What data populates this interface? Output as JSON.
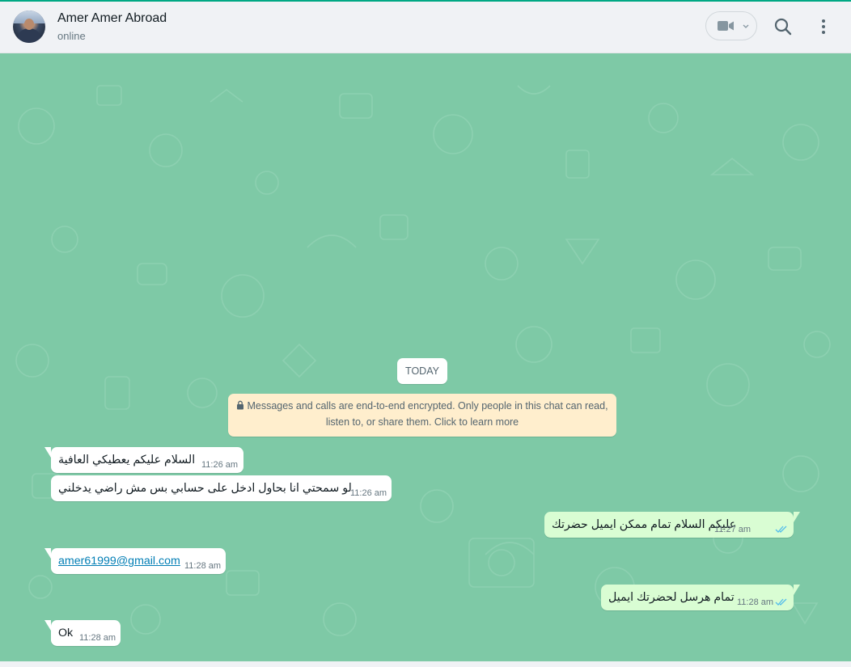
{
  "header": {
    "contact_name": "Amer Amer Abroad",
    "contact_status": "online",
    "icons": [
      "avatar",
      "video-call-icon",
      "chevron-down-icon",
      "search-icon",
      "menu-icon"
    ]
  },
  "chat": {
    "date_chip": "TODAY",
    "encryption_notice_line1": "Messages and calls are end-to-end encrypted. Only people in this chat can read,",
    "encryption_notice_line2": "listen to, or share them. Click to learn more",
    "messages": [
      {
        "direction": "in",
        "text": "السلام عليكم يعطيكي العافية",
        "time": "11:26 am"
      },
      {
        "direction": "in",
        "text": "لو سمحتي انا بحاول ادخل على حسابي بس مش راضي يدخلني",
        "time": "11:26 am"
      },
      {
        "direction": "out",
        "text": "عليكم السلام تمام ممكن ايميل حضرتك",
        "time": "11:27 am",
        "status": "read"
      },
      {
        "direction": "in",
        "text": "amer61999@gmail.com",
        "time": "11:28 am",
        "is_link": true
      },
      {
        "direction": "out",
        "text": "تمام هرسل لحضرتك ايميل",
        "time": "11:28 am",
        "status": "read"
      },
      {
        "direction": "in",
        "text": "Ok",
        "time": "11:28 am"
      }
    ]
  },
  "colors": {
    "accent": "#00a884",
    "header_bg": "#f0f2f5",
    "chat_bg": "#7ec9a6",
    "incoming_bubble": "#ffffff",
    "outgoing_bubble": "#d9fdd3",
    "encryption_bg": "#ffeecd",
    "read_ticks": "#53bdeb"
  }
}
